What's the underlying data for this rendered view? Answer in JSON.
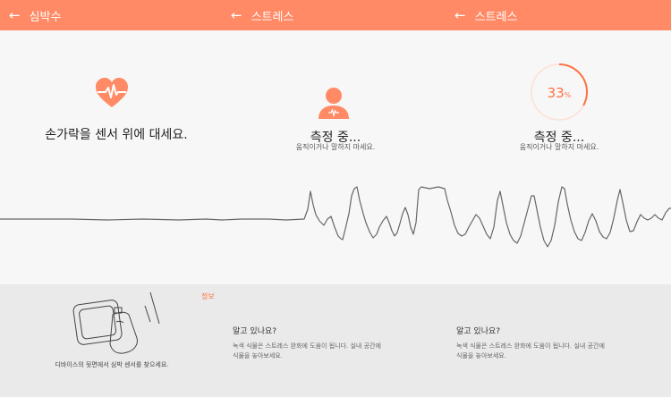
{
  "screens": [
    {
      "title": "심박수",
      "back_icon": "arrow-left-icon"
    },
    {
      "title": "스트레스",
      "back_icon": "arrow-left-icon"
    },
    {
      "title": "스트레스",
      "back_icon": "arrow-left-icon"
    }
  ],
  "panel1": {
    "icon": "heart-pulse-icon",
    "instruction": "손가락을 센서 위에 대세요."
  },
  "panel2": {
    "icon": "person-icon",
    "status": "측정 중...",
    "hint": "움직이거나 말하지 마세요."
  },
  "panel3": {
    "progress_value": "33",
    "progress_unit": "%",
    "progress_fraction": 0.33,
    "status": "측정 중...",
    "hint": "움직이거나 말하지 마세요."
  },
  "bottom1": {
    "info_link": "정보",
    "caption": "디바이스의 뒷면에서 심박 센서를 찾으세요."
  },
  "bottom2": {
    "question": "알고 있나요?",
    "tip_line1": "녹색 식물은 스트레스 완화에 도움이 됩니다. 실내 공간에",
    "tip_line2": "식물을 놓아보세요."
  },
  "bottom3": {
    "question": "알고 있나요?",
    "tip_line1": "녹색 식물은 스트레스 완화에 도움이 됩니다. 실내 공간에",
    "tip_line2": "식물을 놓아보세요."
  },
  "colors": {
    "accent": "#ff8a65",
    "accent_dark": "#ff7043",
    "background": "#f7f7f7",
    "bottom_bg": "#eaeaea",
    "wave": "#666666"
  }
}
